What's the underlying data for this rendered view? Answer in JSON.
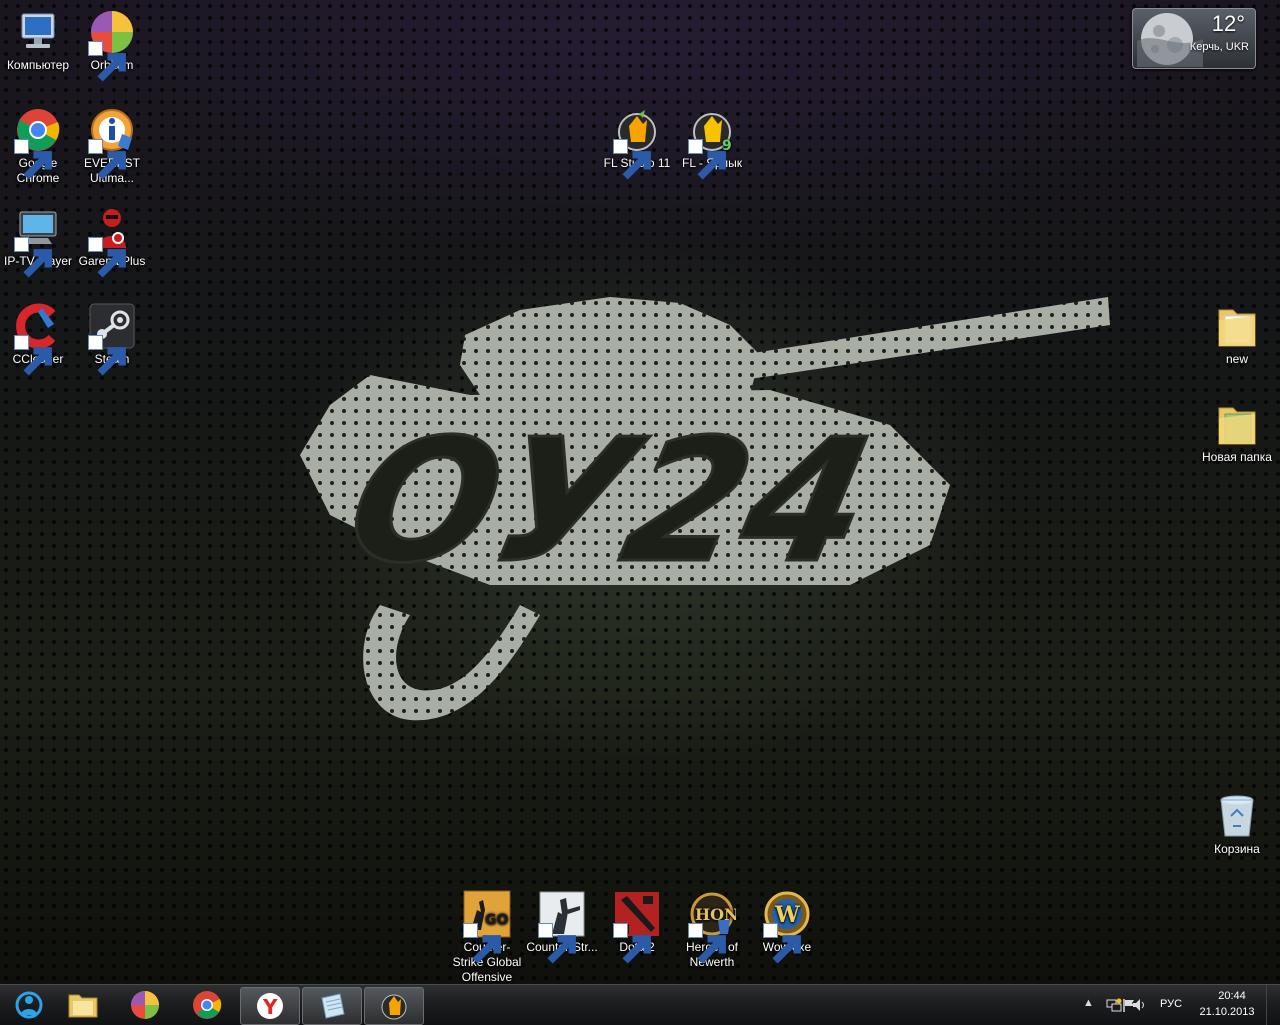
{
  "desktop": {
    "icons": {
      "computer": "Компьютер",
      "orbitum": "Orbitum",
      "chrome": "Google Chrome",
      "everest": "EVEREST Ultima...",
      "iptv": "IP-TV Player",
      "garena": "Garena Plus",
      "ccleaner": "CCleaner",
      "steam": "Steam",
      "fl11": "FL Studio 11",
      "fl_shortcut": "FL - Ярлык",
      "folder_new": "new",
      "folder_newfolder": "Новая папка",
      "recycle_bin": "Корзина",
      "csgo": "Counter-Strike Global Offensive",
      "cs": "Counter-Str...",
      "dota": "Dota 2",
      "hon": "Heroes of Newerth",
      "wow": "Wow.exe"
    },
    "wallpaper_text": "ОУ24"
  },
  "weather": {
    "temperature": "12°",
    "location": "Керчь, UKR"
  },
  "taskbar": {
    "language": "РУС",
    "time": "20:44",
    "date": "21.10.2013",
    "buttons": [
      "network-app",
      "file-explorer",
      "orbitum",
      "google-chrome",
      "yandex-browser",
      "notepad-app",
      "fl-studio"
    ]
  },
  "colors": {
    "taskbar": "#1b1c1d",
    "label_text": "#ffffff"
  }
}
